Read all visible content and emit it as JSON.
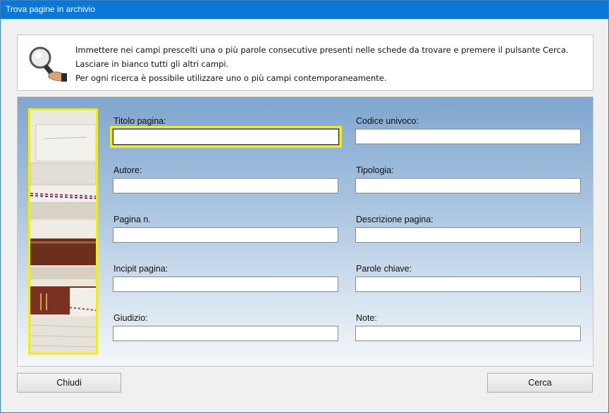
{
  "window": {
    "title": "Trova pagine in archivio"
  },
  "info": {
    "lines": [
      "Immettere nei campi prescelti una o più parole consecutive presenti nelle schede da trovare e premere il pulsante Cerca.",
      "Lasciare in bianco tutti gli altri campi.",
      "Per ogni ricerca è possibile utilizzare uno o più campi contemporaneamente."
    ]
  },
  "fields": {
    "titolo": {
      "label": "Titolo pagina:",
      "value": ""
    },
    "codice": {
      "label": "Codice univoco:",
      "value": ""
    },
    "autore": {
      "label": "Autore:",
      "value": ""
    },
    "tipologia": {
      "label": "Tipologia:",
      "value": ""
    },
    "pagina": {
      "label": "Pagina n.",
      "value": ""
    },
    "descrizione": {
      "label": "Descrizione pagina:",
      "value": ""
    },
    "incipit": {
      "label": "Incipit pagina:",
      "value": ""
    },
    "parole": {
      "label": "Parole chiave:",
      "value": ""
    },
    "giudizio": {
      "label": "Giudizio:",
      "value": ""
    },
    "note": {
      "label": "Note:",
      "value": ""
    }
  },
  "buttons": {
    "close": "Chiudi",
    "search": "Cerca"
  },
  "colors": {
    "titlebar": "#0a78d7",
    "highlight": "#f3ec1b"
  }
}
